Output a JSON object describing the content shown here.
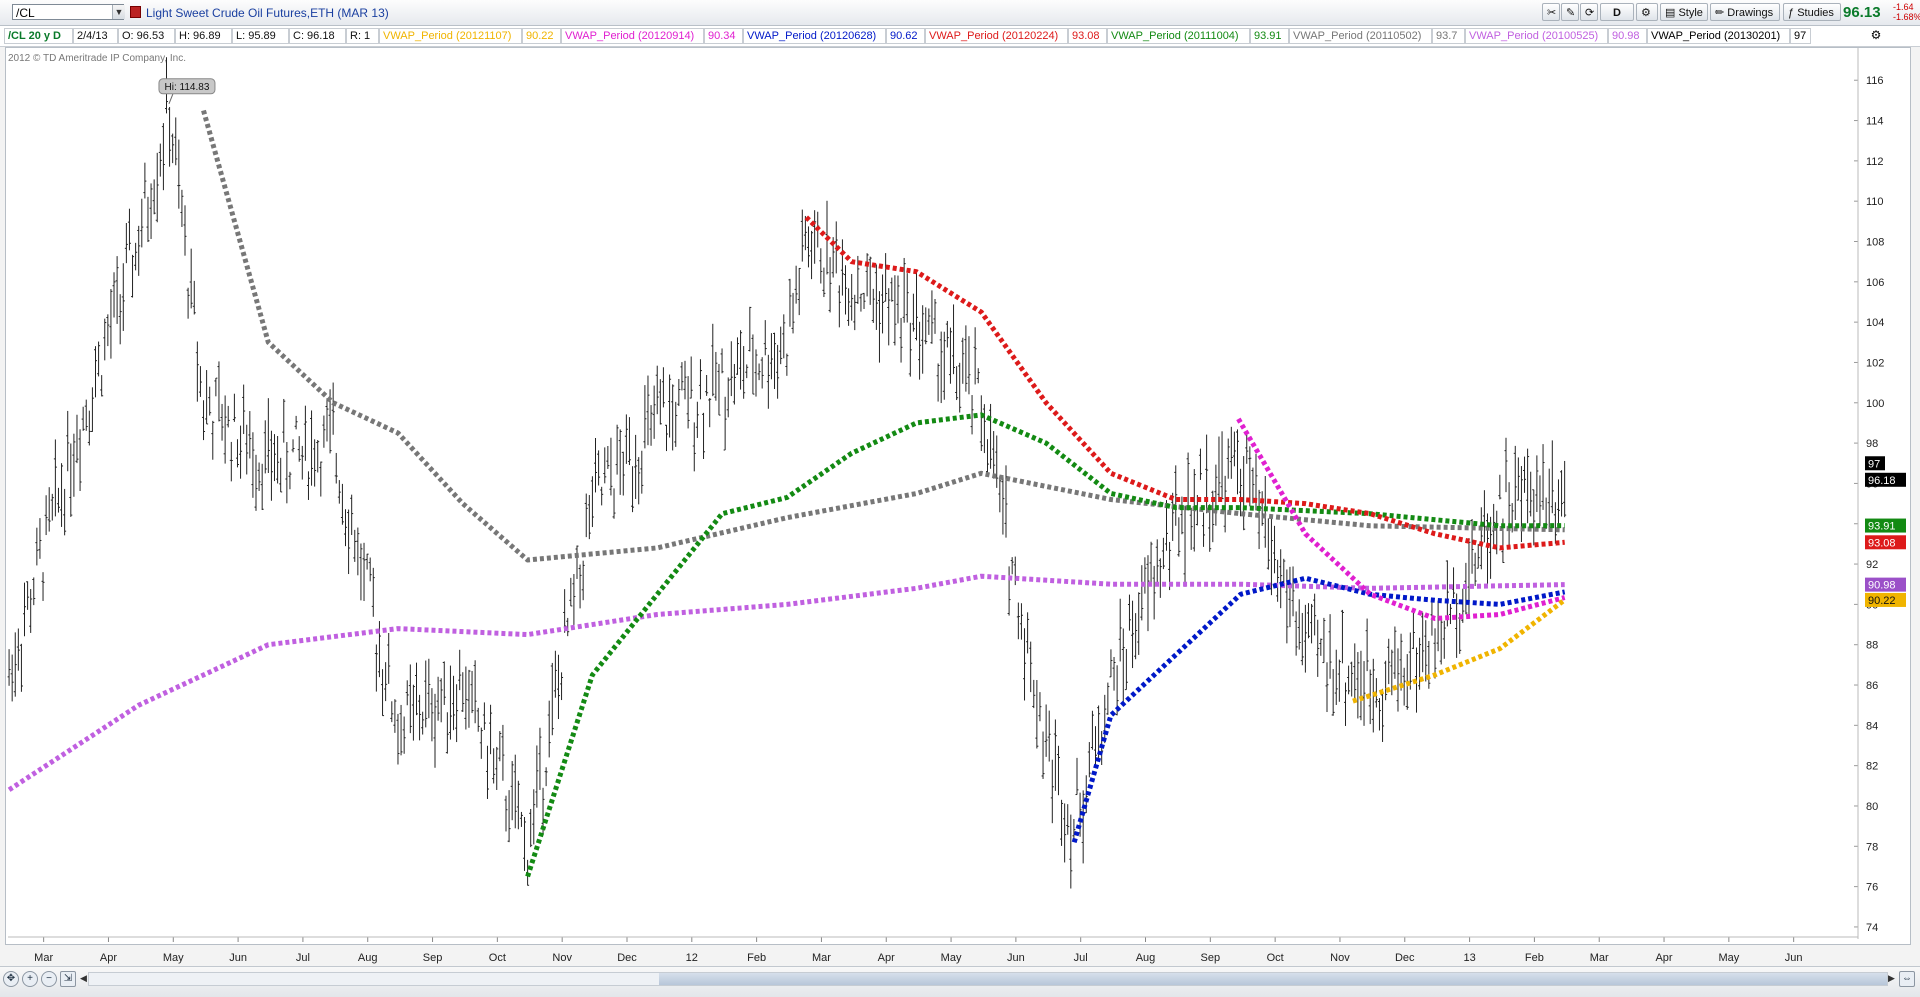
{
  "toolbar": {
    "symbol": "/CL",
    "description": "Light Sweet Crude Oil Futures,ETH (MAR 13)",
    "last_price": "96.13",
    "change": "-1.64",
    "change_pct": "-1.68%",
    "style_label": "Style",
    "drawings_label": "Drawings",
    "studies_label": "Studies",
    "d_label": "D"
  },
  "infobar": {
    "timeframe": "/CL 20 y D",
    "date": "2/4/13",
    "open": "O: 96.53",
    "high": "H: 96.89",
    "low": "L: 95.89",
    "close": "C: 96.18",
    "range": "R: 1",
    "studies": [
      {
        "label": "VWAP_Period (20121107)",
        "value": "90.22",
        "color": "#f0b400"
      },
      {
        "label": "VWAP_Period (20120914)",
        "value": "90.34",
        "color": "#e020d0"
      },
      {
        "label": "VWAP_Period (20120628)",
        "value": "90.62",
        "color": "#0018c8"
      },
      {
        "label": "VWAP_Period (20120224)",
        "value": "93.08",
        "color": "#dd1a1a"
      },
      {
        "label": "VWAP_Period (20111004)",
        "value": "93.91",
        "color": "#138a13"
      },
      {
        "label": "VWAP_Period (20110502)",
        "value": "93.7",
        "color": "#777777"
      },
      {
        "label": "VWAP_Period (20100525)",
        "value": "90.98",
        "color": "#c060e0"
      },
      {
        "label": "VWAP_Period (20130201)",
        "value": "97",
        "color": "#000000"
      }
    ]
  },
  "copyright": "2012 © TD Ameritrade IP Company, Inc.",
  "chart_data": {
    "type": "ohlc",
    "title": "/CL 20 y D",
    "ylim": [
      73.6,
      117.4
    ],
    "y_ticks": [
      74,
      76,
      78,
      80,
      82,
      84,
      86,
      88,
      90,
      92,
      94,
      96,
      98,
      100,
      102,
      104,
      106,
      108,
      110,
      112,
      114,
      116
    ],
    "x_ticks": [
      "Mar",
      "Apr",
      "May",
      "Jun",
      "Jul",
      "Aug",
      "Sep",
      "Oct",
      "Nov",
      "Dec",
      "12",
      "Feb",
      "Mar",
      "Apr",
      "May",
      "Jun",
      "Jul",
      "Aug",
      "Sep",
      "Oct",
      "Nov",
      "Dec",
      "13",
      "Feb",
      "Mar",
      "Apr",
      "May",
      "Jun"
    ],
    "hi_annotation": "Hi: 114.83",
    "price_series": {
      "name": "/CL",
      "x": [
        "2011-02",
        "2011-03",
        "2011-04",
        "2011-04-29",
        "2011-05",
        "2011-06",
        "2011-07",
        "2011-08",
        "2011-09",
        "2011-10",
        "2011-11",
        "2011-12",
        "2012-01",
        "2012-02",
        "2012-02-24",
        "2012-03",
        "2012-04",
        "2012-05",
        "2012-06",
        "2012-06-28",
        "2012-07",
        "2012-08",
        "2012-09",
        "2012-10",
        "2012-11",
        "2012-12",
        "2013-01",
        "2013-02"
      ],
      "close": [
        86.5,
        98,
        108,
        114.5,
        100,
        97,
        98,
        84,
        86,
        78,
        95,
        99,
        101,
        103,
        108,
        106,
        104,
        100,
        83,
        79,
        86,
        94,
        97,
        88,
        86,
        88,
        95,
        96.18
      ]
    },
    "series": [
      {
        "name": "VWAP_Period (20100525)",
        "color": "#c060e0",
        "x": [
          "2011-02",
          "2011-04",
          "2011-06",
          "2011-08",
          "2011-10",
          "2011-12",
          "2012-02",
          "2012-04",
          "2012-05",
          "2012-07",
          "2012-09",
          "2012-11",
          "2013-02"
        ],
        "values": [
          80.8,
          85.0,
          88.0,
          88.8,
          88.5,
          89.5,
          90.0,
          90.8,
          91.4,
          91.0,
          91.0,
          90.8,
          90.98
        ]
      },
      {
        "name": "VWAP_Period (20110502)",
        "color": "#777777",
        "x": [
          "2011-05",
          "2011-06",
          "2011-07",
          "2011-08",
          "2011-09",
          "2011-10",
          "2011-12",
          "2012-02",
          "2012-04",
          "2012-05",
          "2012-07",
          "2012-09",
          "2012-11",
          "2013-02"
        ],
        "values": [
          114.5,
          103,
          100,
          98.5,
          95,
          92.2,
          92.8,
          94.3,
          95.5,
          96.5,
          95.2,
          94.5,
          93.9,
          93.7
        ]
      },
      {
        "name": "VWAP_Period (20111004)",
        "color": "#138a13",
        "x": [
          "2011-10",
          "2011-11",
          "2011-12",
          "2012-01",
          "2012-02",
          "2012-03",
          "2012-04",
          "2012-05",
          "2012-06",
          "2012-07",
          "2012-08",
          "2012-09",
          "2012-11",
          "2013-01",
          "2013-02"
        ],
        "values": [
          76.5,
          86.5,
          90.5,
          94.5,
          95.3,
          97.5,
          99,
          99.4,
          98,
          95.5,
          94.8,
          94.8,
          94.5,
          93.9,
          93.91
        ]
      },
      {
        "name": "VWAP_Period (20120224)",
        "color": "#dd1a1a",
        "x": [
          "2012-02-24",
          "2012-03",
          "2012-04",
          "2012-05",
          "2012-06",
          "2012-07",
          "2012-08",
          "2012-09",
          "2012-10",
          "2012-11",
          "2012-12",
          "2013-01",
          "2013-02"
        ],
        "values": [
          109.2,
          107,
          106.5,
          104.5,
          100,
          96.5,
          95.2,
          95.2,
          95,
          94.5,
          93.5,
          92.8,
          93.08
        ]
      },
      {
        "name": "VWAP_Period (20120628)",
        "color": "#0018c8",
        "x": [
          "2012-06-28",
          "2012-07",
          "2012-08",
          "2012-09",
          "2012-10",
          "2012-11",
          "2012-12",
          "2013-01",
          "2013-02"
        ],
        "values": [
          78.2,
          84.5,
          87.5,
          90.5,
          91.3,
          90.5,
          90.2,
          90.0,
          90.62
        ]
      },
      {
        "name": "VWAP_Period (20120914)",
        "color": "#e020d0",
        "x": [
          "2012-09-14",
          "2012-10",
          "2012-11",
          "2012-12",
          "2013-01",
          "2013-02"
        ],
        "values": [
          99.2,
          93.5,
          90.5,
          89.3,
          89.5,
          90.34
        ]
      },
      {
        "name": "VWAP_Period (20121107)",
        "color": "#f0b400",
        "x": [
          "2012-11-07",
          "2012-12",
          "2013-01",
          "2013-02"
        ],
        "values": [
          85.2,
          86.5,
          87.8,
          90.22
        ]
      }
    ],
    "price_labels": [
      {
        "value": "97",
        "bg": "#000000"
      },
      {
        "value": "96.18",
        "bg": "#000000"
      },
      {
        "value": "93.91",
        "bg": "#138a13"
      },
      {
        "value": "93.08",
        "bg": "#dd1a1a"
      },
      {
        "value": "90.98",
        "bg": "#9b50c8"
      },
      {
        "value": "90.22",
        "bg": "#f0b400"
      }
    ]
  }
}
